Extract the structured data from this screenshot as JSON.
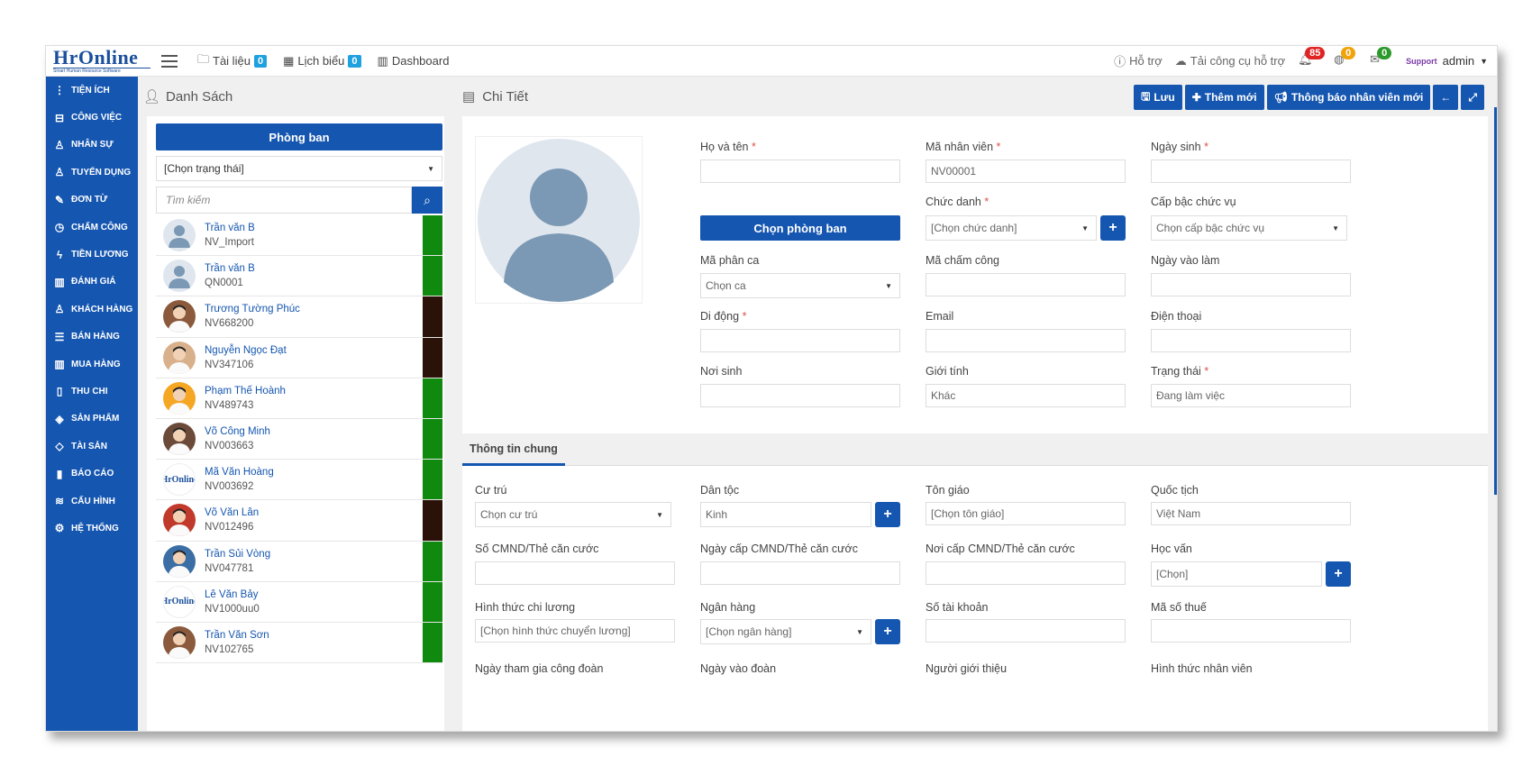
{
  "topbar": {
    "logo": "HrOnline",
    "logo_sub": "Smart Human Resource Software",
    "nav": [
      {
        "label": "Tài liệu",
        "badge": "0"
      },
      {
        "label": "Lịch biểu",
        "badge": "0"
      },
      {
        "label": "Dashboard"
      }
    ],
    "help": "Hỗ trợ",
    "download_tool": "Tải công cụ hỗ trợ",
    "notifications": {
      "bell": "85",
      "globe": "0",
      "chat": "0"
    },
    "support_logo": "Support",
    "user": "admin"
  },
  "sidebar": {
    "items": [
      {
        "label": "TIỆN ÍCH",
        "icon": "vertical-dots-icon"
      },
      {
        "label": "CÔNG VIỆC",
        "icon": "inbox-icon"
      },
      {
        "label": "NHÂN SỰ",
        "icon": "user-icon"
      },
      {
        "label": "TUYỂN DỤNG",
        "icon": "user-plus-icon"
      },
      {
        "label": "ĐƠN TỪ",
        "icon": "edit-icon"
      },
      {
        "label": "CHẤM CÔNG",
        "icon": "clock-icon"
      },
      {
        "label": "TIỀN LƯƠNG",
        "icon": "bolt-icon"
      },
      {
        "label": "ĐÁNH GIÁ",
        "icon": "book-icon"
      },
      {
        "label": "KHÁCH HÀNG",
        "icon": "customer-icon"
      },
      {
        "label": "BÁN HÀNG",
        "icon": "list-icon"
      },
      {
        "label": "MUA HÀNG",
        "icon": "columns-icon"
      },
      {
        "label": "THU CHI",
        "icon": "file-icon"
      },
      {
        "label": "SẢN PHẨM",
        "icon": "tag-icon"
      },
      {
        "label": "TÀI SẢN",
        "icon": "diamond-icon"
      },
      {
        "label": "BÁO CÁO",
        "icon": "bar-chart-icon"
      },
      {
        "label": "CẤU HÌNH",
        "icon": "layers-icon"
      },
      {
        "label": "HỆ THỐNG",
        "icon": "cog-icon"
      }
    ]
  },
  "list": {
    "title": "Danh Sách",
    "department_button": "Phòng ban",
    "status_select": "[Chọn trạng thái]",
    "search_placeholder": "Tìm kiếm",
    "employees": [
      {
        "name": "Trần văn B",
        "code": "NV_Import",
        "bar": "#0f8a0f",
        "avatar": "default"
      },
      {
        "name": "Trần văn B",
        "code": "QN0001",
        "bar": "#0f8a0f",
        "avatar": "default"
      },
      {
        "name": "Trương Tường Phúc",
        "code": "NV668200",
        "bar": "#2b1208",
        "avatar": "photo"
      },
      {
        "name": "Nguyễn Ngọc Đạt",
        "code": "NV347106",
        "bar": "#2b1208",
        "avatar": "photo"
      },
      {
        "name": "Phạm Thế Hoành",
        "code": "NV489743",
        "bar": "#0f8a0f",
        "avatar": "photo"
      },
      {
        "name": "Võ Công Minh",
        "code": "NV003663",
        "bar": "#0f8a0f",
        "avatar": "photo"
      },
      {
        "name": "Mã Văn Hoàng",
        "code": "NV003692",
        "bar": "#0f8a0f",
        "avatar": "logo"
      },
      {
        "name": "Võ Văn Lân",
        "code": "NV012496",
        "bar": "#2b1208",
        "avatar": "photo"
      },
      {
        "name": "Trần Sủi Vòng",
        "code": "NV047781",
        "bar": "#0f8a0f",
        "avatar": "photo"
      },
      {
        "name": "Lê Văn Bảy",
        "code": "NV1000uu0",
        "bar": "#0f8a0f",
        "avatar": "logo"
      },
      {
        "name": "Trần Văn Sơn",
        "code": "NV102765",
        "bar": "#0f8a0f",
        "avatar": "photo"
      }
    ]
  },
  "detail": {
    "title": "Chi Tiết",
    "buttons": {
      "save": "Lưu",
      "add": "Thêm mới",
      "notify": "Thông báo nhân viên mới"
    },
    "choose_department": "Chọn phòng ban",
    "fields": {
      "full_name": "Họ và tên",
      "employee_code": "Mã nhân viên",
      "employee_code_value": "NV00001",
      "birthday": "Ngày sinh",
      "job_title": "Chức danh",
      "job_title_value": "[Chọn chức danh]",
      "rank": "Cấp bậc chức vụ",
      "rank_value": "Chọn cấp bậc chức vụ",
      "shift_code": "Mã phân ca",
      "shift_value": "Chọn ca",
      "attendance_code": "Mã chấm công",
      "start_date": "Ngày vào làm",
      "mobile": "Di động",
      "email": "Email",
      "phone": "Điện thoại",
      "birthplace": "Nơi sinh",
      "gender": "Giới tính",
      "gender_value": "Khác",
      "status": "Trạng thái",
      "status_value": "Đang làm việc"
    },
    "tab": "Thông tin chung",
    "general": {
      "residence": "Cư trú",
      "residence_value": "Chọn cư trú",
      "ethnicity": "Dân tộc",
      "ethnicity_value": "Kinh",
      "religion": "Tôn giáo",
      "religion_value": "[Chọn tôn giáo]",
      "nationality": "Quốc tịch",
      "nationality_value": "Việt Nam",
      "id_number": "Số CMND/Thẻ căn cước",
      "id_date": "Ngày cấp CMND/Thẻ căn cước",
      "id_place": "Nơi cấp CMND/Thẻ căn cước",
      "education": "Học vấn",
      "education_value": "[Chọn]",
      "salary_method": "Hình thức chi lương",
      "salary_method_value": "[Chọn hình thức chuyển lương]",
      "bank": "Ngân hàng",
      "bank_value": "[Chọn ngân hàng]",
      "account_number": "Số tài khoản",
      "tax_code": "Mã số thuế",
      "union_date": "Ngày tham gia công đoàn",
      "youth_union_date": "Ngày vào đoàn",
      "referrer": "Người giới thiệu",
      "employee_type": "Hình thức nhân viên"
    }
  }
}
